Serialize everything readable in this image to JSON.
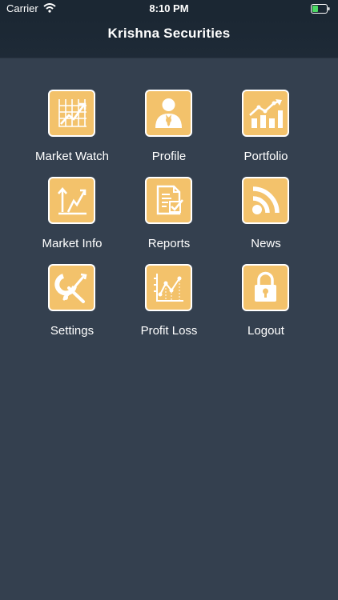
{
  "status": {
    "carrier": "Carrier",
    "time": "8:10 PM"
  },
  "header": {
    "title": "Krishna Securities"
  },
  "menu": {
    "items": [
      {
        "label": "Market Watch",
        "icon": "market-watch-icon"
      },
      {
        "label": "Profile",
        "icon": "profile-icon"
      },
      {
        "label": "Portfolio",
        "icon": "portfolio-icon"
      },
      {
        "label": "Market Info",
        "icon": "market-info-icon"
      },
      {
        "label": "Reports",
        "icon": "reports-icon"
      },
      {
        "label": "News",
        "icon": "news-icon"
      },
      {
        "label": "Settings",
        "icon": "settings-icon"
      },
      {
        "label": "Profit Loss",
        "icon": "profit-loss-icon"
      },
      {
        "label": "Logout",
        "icon": "logout-icon"
      }
    ]
  },
  "colors": {
    "background": "#34404f",
    "header": "#1b2733",
    "tile": "#f3c26b",
    "tile_border": "#ffffff"
  }
}
